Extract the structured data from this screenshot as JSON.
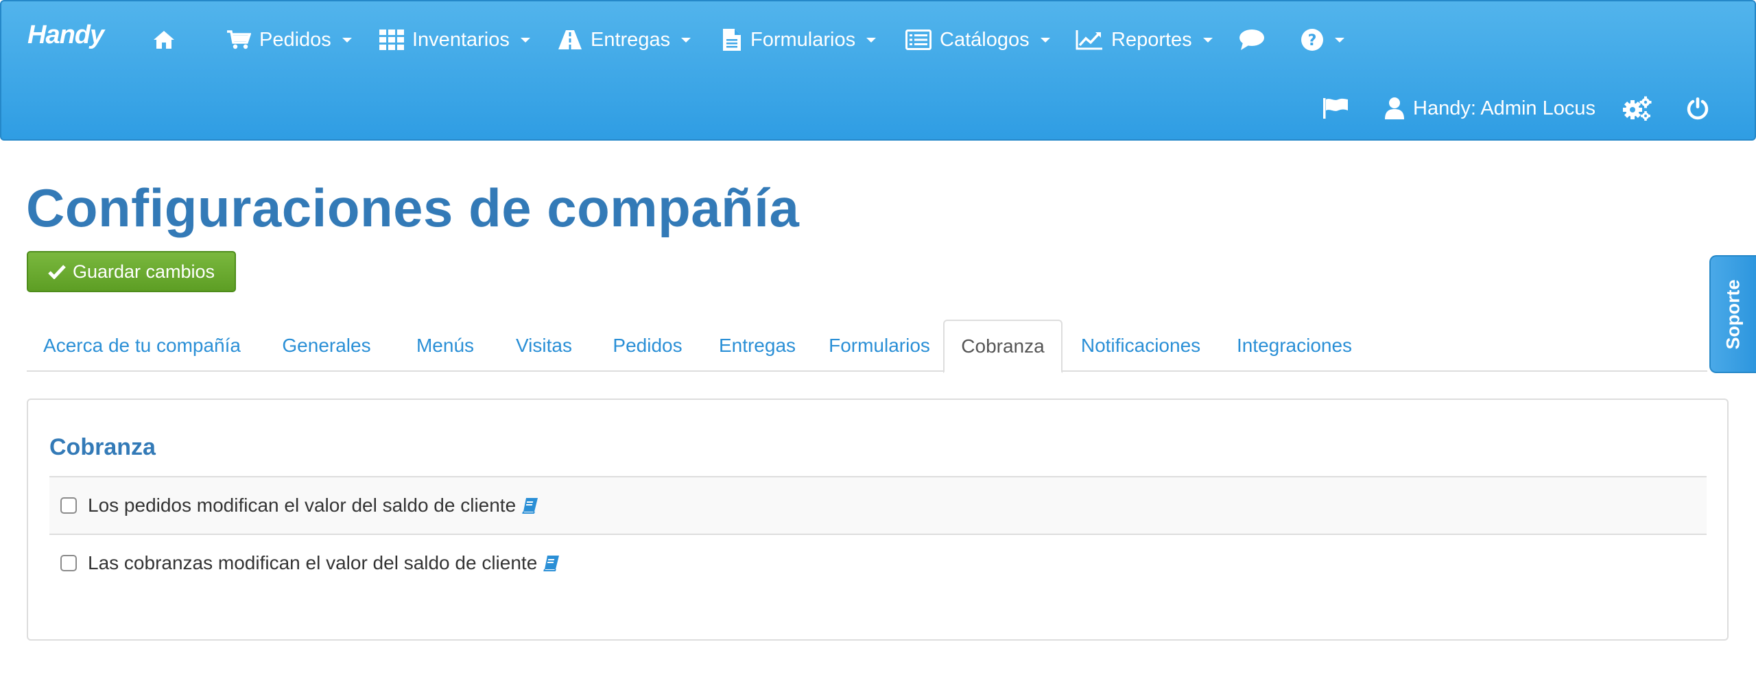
{
  "app": {
    "brand": "Handy"
  },
  "nav": {
    "home_icon": "home-icon",
    "items": [
      {
        "label": "Pedidos",
        "icon": "cart-icon"
      },
      {
        "label": "Inventarios",
        "icon": "grid-icon"
      },
      {
        "label": "Entregas",
        "icon": "road-icon"
      },
      {
        "label": "Formularios",
        "icon": "file-icon"
      },
      {
        "label": "Catálogos",
        "icon": "list-icon"
      },
      {
        "label": "Reportes",
        "icon": "line-chart-icon"
      }
    ],
    "chat_icon": "chat-icon",
    "help_icon": "question-circle-icon",
    "user_label": "Handy: Admin Locus",
    "flag_icon": "flag-icon",
    "user_icon": "user-icon",
    "settings_icon": "gears-icon",
    "power_icon": "power-icon"
  },
  "page": {
    "title": "Configuraciones de compañía",
    "save_label": "Guardar cambios"
  },
  "tabs": [
    {
      "label": "Acerca de tu compañía",
      "active": false
    },
    {
      "label": "Generales",
      "active": false
    },
    {
      "label": "Menús",
      "active": false
    },
    {
      "label": "Visitas",
      "active": false
    },
    {
      "label": "Pedidos",
      "active": false
    },
    {
      "label": "Entregas",
      "active": false
    },
    {
      "label": "Formularios",
      "active": false
    },
    {
      "label": "Cobranza",
      "active": true
    },
    {
      "label": "Notificaciones",
      "active": false
    },
    {
      "label": "Integraciones",
      "active": false
    }
  ],
  "panel": {
    "title": "Cobranza",
    "options": [
      {
        "label": "Los pedidos modifican el valor del saldo de cliente",
        "checked": false,
        "icon": "book-icon"
      },
      {
        "label": "Las cobranzas modifican el valor del saldo de cliente",
        "checked": false,
        "icon": "book-icon"
      }
    ]
  },
  "support": {
    "label": "Soporte"
  },
  "colors": {
    "navbar": "#3da6e8",
    "primary_text": "#337ab7",
    "link": "#2a8fd6",
    "success": "#6aac2f"
  }
}
